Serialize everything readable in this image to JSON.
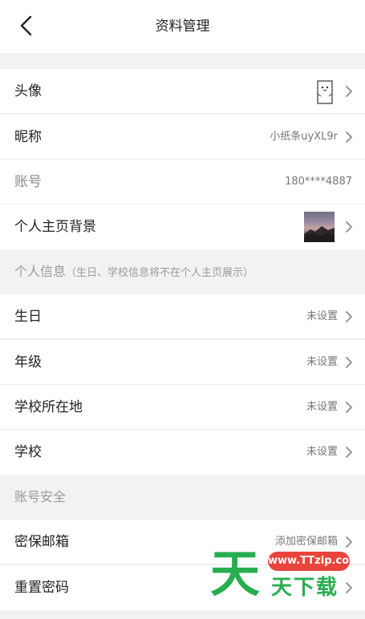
{
  "header": {
    "title": "资料管理",
    "back_icon": "chevron-left-icon"
  },
  "rows": {
    "avatar": {
      "label": "头像"
    },
    "nickname": {
      "label": "昵称",
      "value": "小纸条uyXL9r"
    },
    "account": {
      "label": "账号",
      "value": "180****4887"
    },
    "background": {
      "label": "个人主页背景"
    },
    "birthday": {
      "label": "生日",
      "value": "未设置"
    },
    "grade": {
      "label": "年级",
      "value": "未设置"
    },
    "school_location": {
      "label": "学校所在地",
      "value": "未设置"
    },
    "school": {
      "label": "学校",
      "value": "未设置"
    },
    "security_email": {
      "label": "密保邮箱",
      "value": "添加密保邮箱"
    },
    "reset_password": {
      "label": "重置密码"
    }
  },
  "sections": {
    "personal_info": {
      "title": "个人信息",
      "note": "（生日、学校信息将不在个人主页展示）"
    },
    "account_security": {
      "title": "账号安全"
    }
  },
  "watermark": {
    "big_char": "天",
    "url": "www.TTzip.com",
    "text": "天下载"
  },
  "colors": {
    "background": "#f2f2f2",
    "watermark_green": "#27ae4f",
    "watermark_red": "#e8443b"
  }
}
